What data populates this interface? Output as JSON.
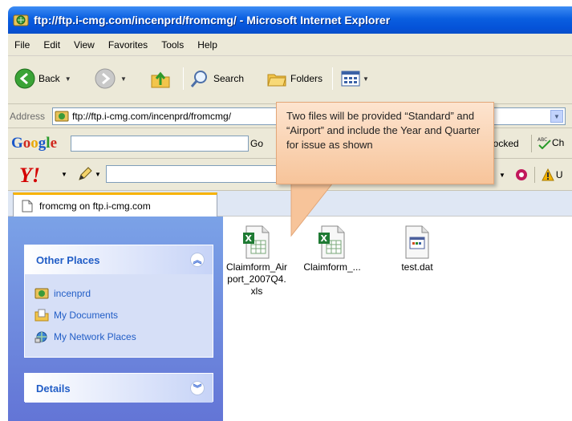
{
  "window": {
    "title": "ftp://ftp.i-cmg.com/incenprd/fromcmg/ - Microsoft Internet Explorer"
  },
  "menu": [
    "File",
    "Edit",
    "View",
    "Favorites",
    "Tools",
    "Help"
  ],
  "toolbar": {
    "back_label": "Back",
    "search_label": "Search",
    "folders_label": "Folders"
  },
  "address": {
    "label": "Address",
    "value": "ftp://ftp.i-cmg.com/incenprd/fromcmg/"
  },
  "google": {
    "logo": "Google",
    "go_label": "Go",
    "blocked_label": "locked",
    "check_label": "Ch"
  },
  "yahoo": {
    "logo": "Y!",
    "right_label": "U"
  },
  "tab": {
    "label": "fromcmg on ftp.i-cmg.com"
  },
  "other_places": {
    "title": "Other Places",
    "items": [
      {
        "label": "incenprd",
        "icon": "ftp-folder-icon"
      },
      {
        "label": "My Documents",
        "icon": "my-documents-icon"
      },
      {
        "label": "My Network Places",
        "icon": "network-places-icon"
      }
    ]
  },
  "details": {
    "title": "Details"
  },
  "files": [
    {
      "name": "Claimform_Airport_2007Q4.xls",
      "icon": "excel-file-icon"
    },
    {
      "name": "Claimform_...",
      "icon": "excel-file-icon"
    },
    {
      "name": "test.dat",
      "icon": "dat-file-icon"
    }
  ],
  "callout": {
    "text": "Two files will be provided “Standard” and “Airport” and include the Year and Quarter for issue as shown"
  },
  "colors": {
    "title_bar": "#0a5fe0",
    "task_pane": "#6f8ee0",
    "task_link": "#215dc6",
    "callout": "#f9cfa8",
    "tab_accent": "#f7b200"
  }
}
